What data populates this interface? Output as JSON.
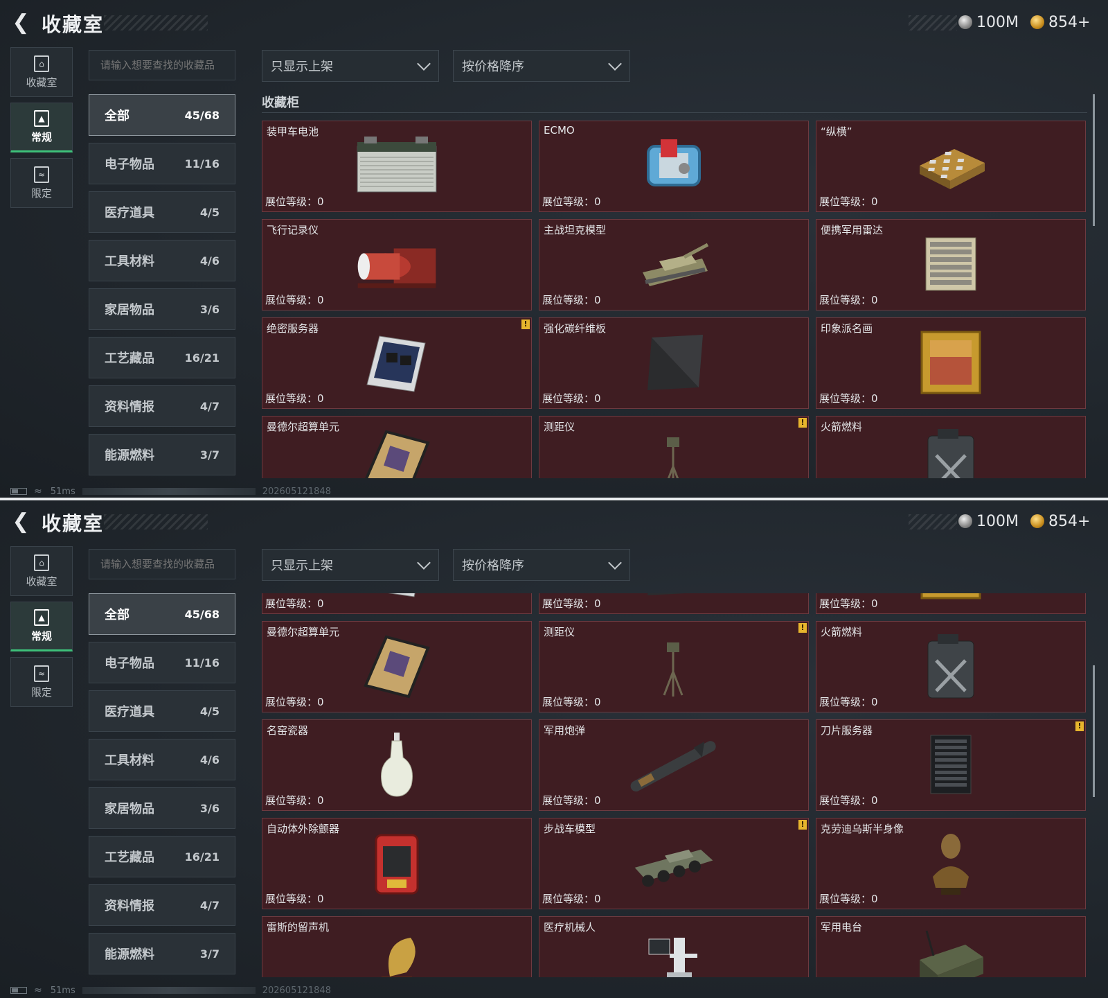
{
  "header": {
    "title": "收藏室",
    "currency1": "100M",
    "currency2": "854+"
  },
  "nav": [
    {
      "label": "收藏室",
      "icon": "vault-icon"
    },
    {
      "label": "常规",
      "icon": "document-icon"
    },
    {
      "label": "限定",
      "icon": "picture-icon"
    }
  ],
  "search": {
    "placeholder": "请输入想要查找的收藏品"
  },
  "filters": {
    "shelf": "只显示上架",
    "sort": "按价格降序"
  },
  "section_title": "收藏柜",
  "categories": [
    {
      "label": "全部",
      "count": "45/68"
    },
    {
      "label": "电子物品",
      "count": "11/16"
    },
    {
      "label": "医疗道具",
      "count": "4/5"
    },
    {
      "label": "工具材料",
      "count": "4/6"
    },
    {
      "label": "家居物品",
      "count": "3/6"
    },
    {
      "label": "工艺藏品",
      "count": "16/21"
    },
    {
      "label": "资料情报",
      "count": "4/7"
    },
    {
      "label": "能源燃料",
      "count": "3/7"
    }
  ],
  "level_label": "展位等级：0",
  "items": [
    {
      "name": "装甲车电池",
      "warn": false,
      "icon": "battery-icon"
    },
    {
      "name": "ECMO",
      "warn": false,
      "icon": "ecmo-machine-icon"
    },
    {
      "name": "“纵横”",
      "warn": false,
      "icon": "chessboard-icon"
    },
    {
      "name": "飞行记录仪",
      "warn": false,
      "icon": "flight-recorder-icon"
    },
    {
      "name": "主战坦克模型",
      "warn": false,
      "icon": "tank-model-icon"
    },
    {
      "name": "便携军用雷达",
      "warn": false,
      "icon": "radar-icon"
    },
    {
      "name": "绝密服务器",
      "warn": true,
      "icon": "server-board-icon"
    },
    {
      "name": "强化碳纤维板",
      "warn": false,
      "icon": "carbon-plate-icon"
    },
    {
      "name": "印象派名画",
      "warn": false,
      "icon": "painting-icon"
    },
    {
      "name": "曼德尔超算单元",
      "warn": false,
      "icon": "supercomputer-unit-icon"
    },
    {
      "name": "测距仪",
      "warn": true,
      "icon": "rangefinder-icon"
    },
    {
      "name": "火箭燃料",
      "warn": false,
      "icon": "fuel-canister-icon"
    },
    {
      "name": "名窑瓷器",
      "warn": false,
      "icon": "porcelain-vase-icon"
    },
    {
      "name": "军用炮弹",
      "warn": false,
      "icon": "artillery-shell-icon"
    },
    {
      "name": "刀片服务器",
      "warn": true,
      "icon": "blade-server-icon"
    },
    {
      "name": "自动体外除颤器",
      "warn": false,
      "icon": "defibrillator-icon"
    },
    {
      "name": "步战车模型",
      "warn": true,
      "icon": "ifv-model-icon"
    },
    {
      "name": "克劳迪乌斯半身像",
      "warn": false,
      "icon": "bust-icon"
    },
    {
      "name": "雷斯的留声机",
      "warn": false,
      "icon": "gramophone-icon"
    },
    {
      "name": "医疗机械人",
      "warn": false,
      "icon": "medical-robot-icon"
    },
    {
      "name": "军用电台",
      "warn": false,
      "icon": "radio-icon"
    }
  ],
  "status": {
    "ping": "51ms",
    "timestamp": "202605121848"
  },
  "colors": {
    "card_bg": "#3f1d22",
    "card_border": "#6d3a40",
    "active_accent": "#3ec07a",
    "warn": "#e7b52d"
  }
}
